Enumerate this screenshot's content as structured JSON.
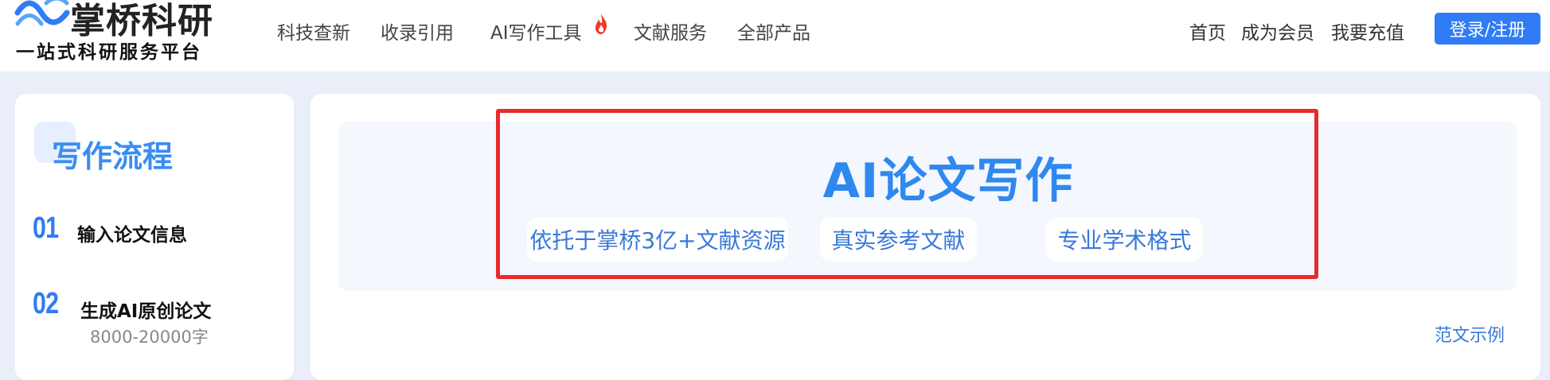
{
  "brand": {
    "name": "掌桥科研",
    "tagline": "一站式科研服务平台",
    "logo_icon": "wave-logo-icon",
    "color": "#2f7cf6"
  },
  "nav": {
    "items": [
      {
        "label": "科技查新"
      },
      {
        "label": "收录引用"
      },
      {
        "label": "AI写作工具",
        "badge_icon": "flame-icon"
      },
      {
        "label": "文献服务"
      },
      {
        "label": "全部产品"
      }
    ],
    "right": [
      {
        "label": "首页"
      },
      {
        "label": "成为会员"
      },
      {
        "label": "我要充值"
      }
    ],
    "login_label": "登录/注册"
  },
  "sidebar": {
    "title": "写作流程",
    "steps": [
      {
        "num": "01",
        "label": "输入论文信息"
      },
      {
        "num": "02",
        "label": "生成AI原创论文",
        "sub": "8000-20000字"
      }
    ]
  },
  "hero": {
    "title": "AI论文写作",
    "features": [
      "依托于掌桥3亿+文献资源",
      "真实参考文献",
      "专业学术格式"
    ]
  },
  "main": {
    "example_link": "范文示例"
  },
  "colors": {
    "accent": "#2f7cf6",
    "title_blue": "#2f88ee",
    "highlight_red": "#ea2a2a",
    "page_bg": "#e9eef8"
  }
}
